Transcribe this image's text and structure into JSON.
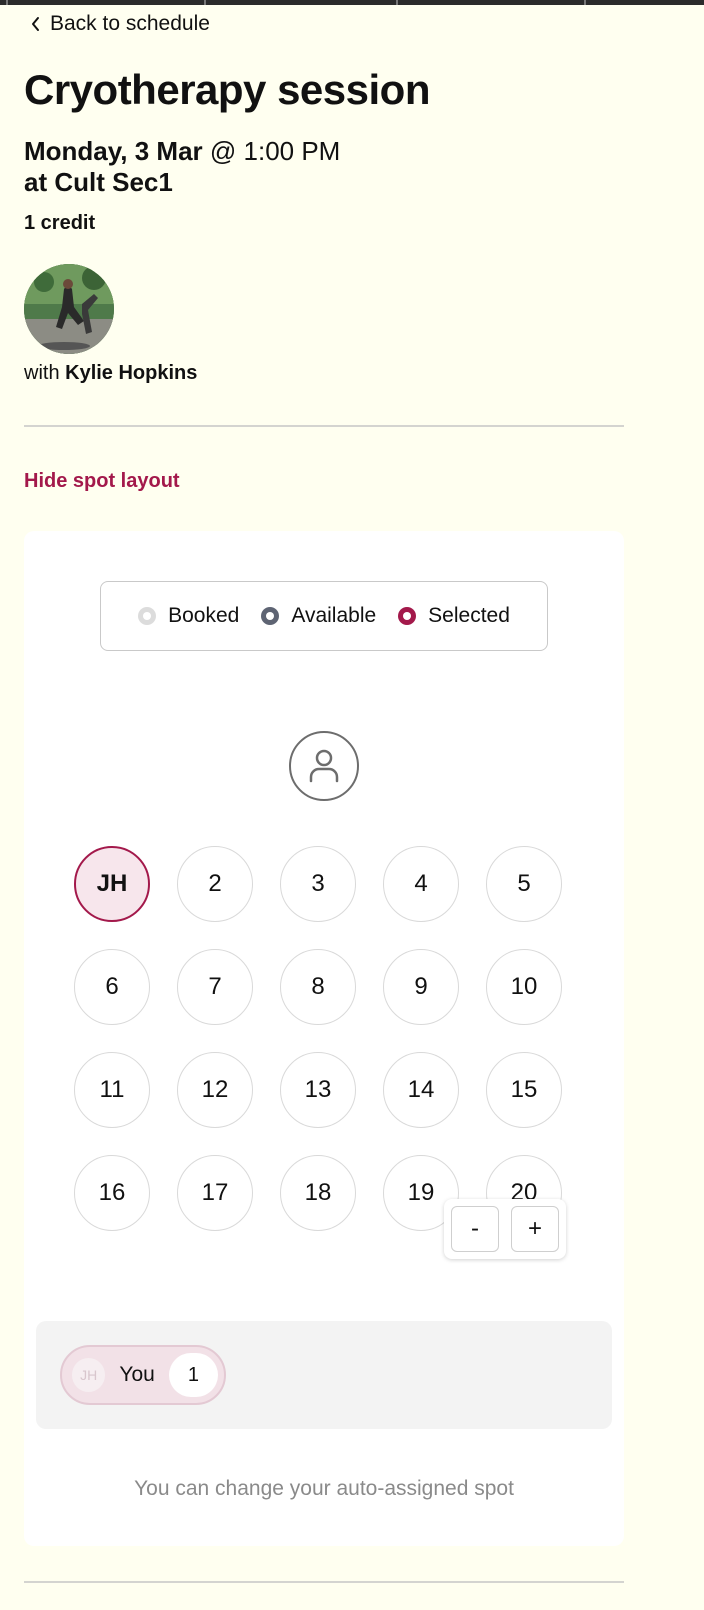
{
  "header": {
    "back_label": "Back to schedule"
  },
  "session": {
    "title": "Cryotherapy session",
    "date": "Monday, 3 Mar",
    "time_sep": " @ ",
    "time": "1:00 PM",
    "location": "at Cult Sec1",
    "credits": "1 credit",
    "instructor_prefix": "with ",
    "instructor_name": "Kylie Hopkins"
  },
  "layout_toggle": "Hide spot layout",
  "legend": {
    "booked": "Booked",
    "available": "Available",
    "selected": "Selected"
  },
  "spots": [
    "JH",
    "2",
    "3",
    "4",
    "5",
    "6",
    "7",
    "8",
    "9",
    "10",
    "11",
    "12",
    "13",
    "14",
    "15",
    "16",
    "17",
    "18",
    "19",
    "20"
  ],
  "selected_spot_index": 0,
  "zoom": {
    "minus": "-",
    "plus": "+"
  },
  "attendees": {
    "you_initials": "JH",
    "you_label": "You",
    "you_count": "1"
  },
  "note": "You can change your auto-assigned spot",
  "colors": {
    "accent": "#a3194b",
    "background": "#fffff0",
    "available_dot": "#5e6473",
    "booked_dot": "#dcdcdc"
  },
  "icons": {
    "back": "chevron-left-icon",
    "instructor_spot": "person-icon"
  }
}
